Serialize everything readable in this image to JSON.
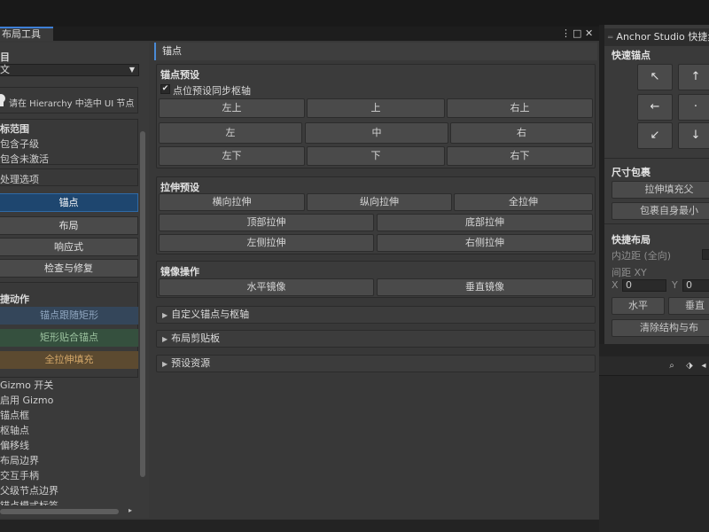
{
  "window": {
    "tab_title": "布局工具",
    "kebab_glyph": "⋮",
    "maximize_glyph": "□",
    "close_glyph": "✕"
  },
  "left": {
    "target_heading": "目",
    "language_value": "文",
    "dropdown_arrow": "▼",
    "selection_hint": "请在 Hierarchy 中选中 UI 节点",
    "scope_heading": "标范围",
    "scope_items": [
      "包含子级",
      "包含未激活"
    ],
    "batch_options": "处理选项",
    "nav": [
      "锚点",
      "布局",
      "响应式",
      "检查与修复"
    ],
    "actions_heading": "捷动作",
    "actions": [
      "锚点跟随矩形",
      "矩形贴合锚点",
      "全拉伸填充"
    ],
    "gizmo_items": [
      "Gizmo 开关",
      "启用 Gizmo",
      "锚点框",
      "枢轴点",
      "偏移线",
      "布局边界",
      "交互手柄",
      "父级节点边界",
      "锚点模式标签"
    ],
    "scroll_right_glyph": "▸"
  },
  "main": {
    "title": "锚点",
    "anchor_presets": {
      "title": "锚点预设",
      "checkbox_label": "点位预设同步枢轴",
      "check_glyph": "✔",
      "rows": [
        [
          "左上",
          "上",
          "右上"
        ],
        [
          "左",
          "中",
          "右"
        ],
        [
          "左下",
          "下",
          "右下"
        ]
      ]
    },
    "stretch_presets": {
      "title": "拉伸预设",
      "row1": [
        "横向拉伸",
        "纵向拉伸",
        "全拉伸"
      ],
      "row2": [
        "顶部拉伸",
        "底部拉伸"
      ],
      "row3": [
        "左侧拉伸",
        "右侧拉伸"
      ]
    },
    "mirror": {
      "title": "镜像操作",
      "buttons": [
        "水平镜像",
        "垂直镜像"
      ]
    },
    "foldouts": [
      "自定义锚点与枢轴",
      "布局剪贴板",
      "预设资源"
    ],
    "fold_glyph": "▶"
  },
  "quick": {
    "title": "Anchor Studio 快捷步",
    "grip_glyph": "═",
    "quick_anchor_heading": "快速锚点",
    "arrows": [
      "↖",
      "↑",
      "←",
      "·",
      "↙",
      "↓"
    ],
    "size_heading": "尺寸包裹",
    "size_buttons": [
      "拉伸填充父",
      "包裹自身最小"
    ],
    "layout_heading": "快捷布局",
    "padding_label": "内边距 (全向)",
    "spacing_label": "间距 XY",
    "x_label": "X",
    "x_value": "0",
    "y_label": "Y",
    "y_value": "0",
    "dir_buttons": [
      "水平",
      "垂直"
    ],
    "clear_button": "清除结构与布"
  },
  "scene": {
    "icons": [
      "⌕",
      "⬗",
      "◂"
    ]
  }
}
